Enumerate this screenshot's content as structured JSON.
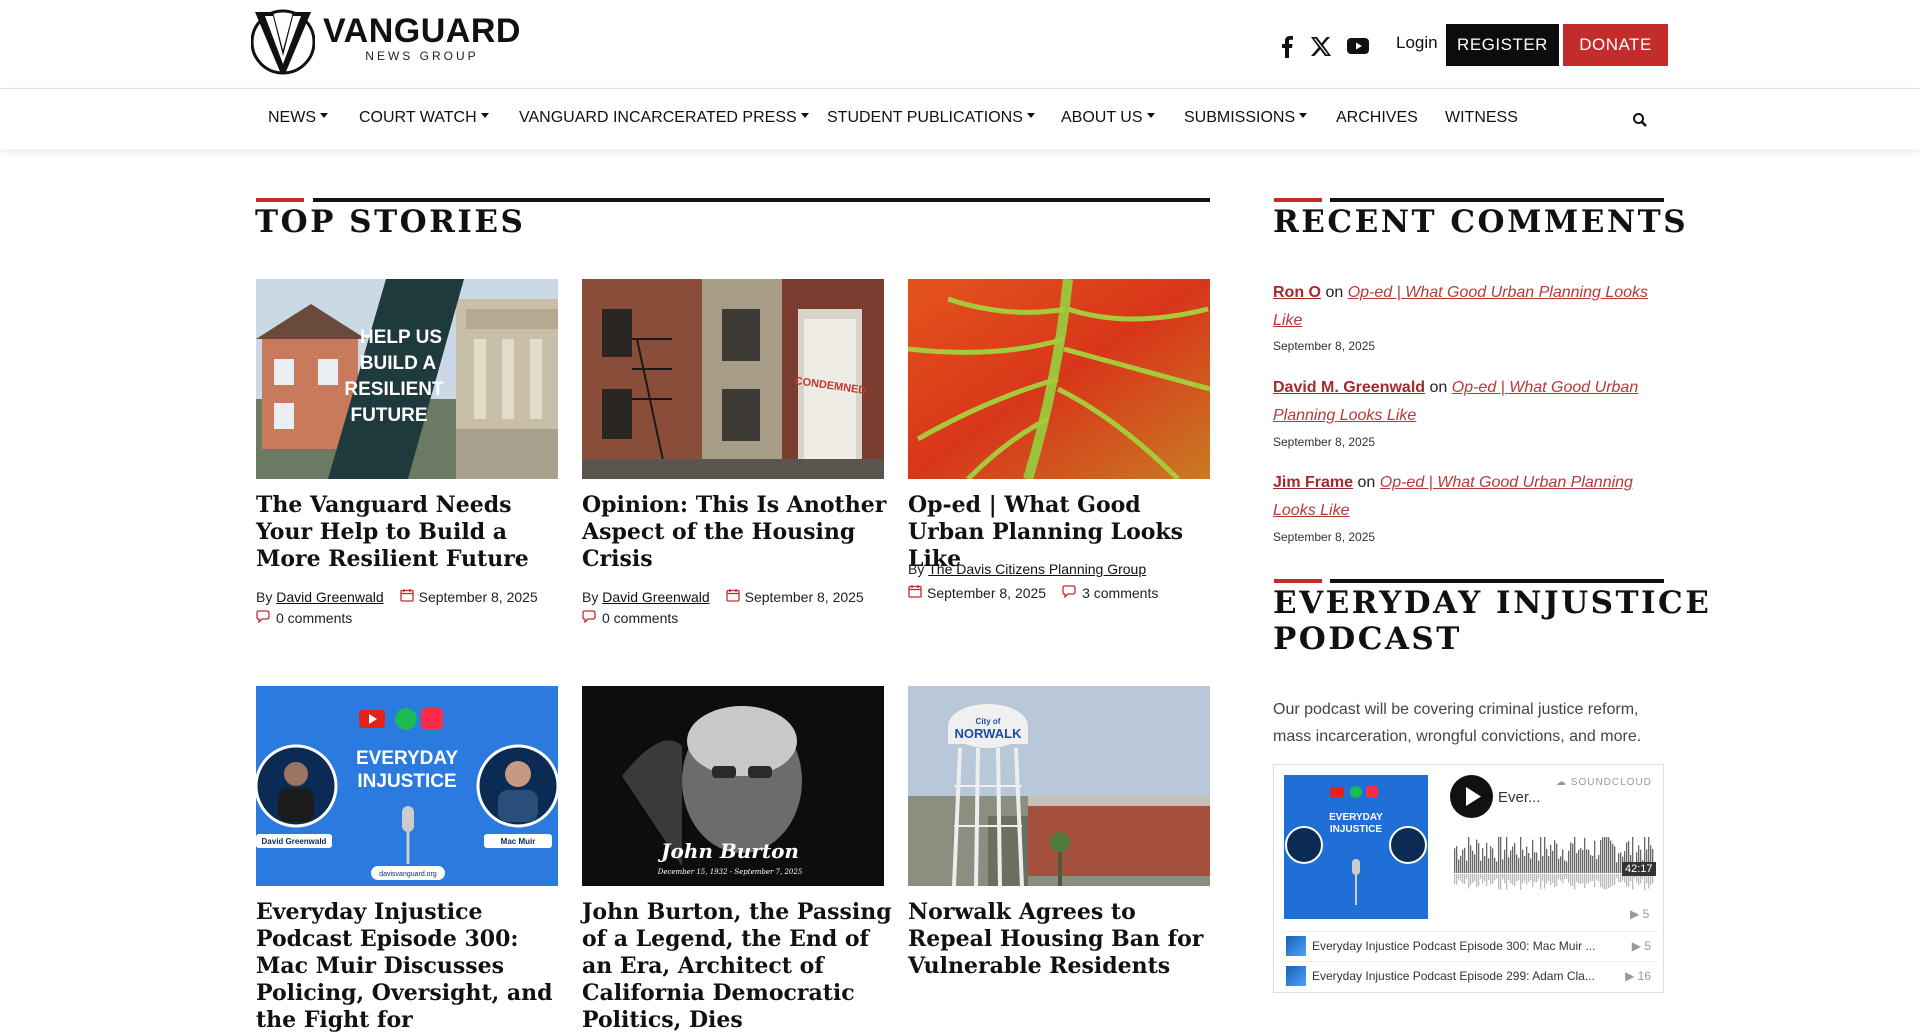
{
  "brand": {
    "name": "VANGUARD",
    "sub": "NEWS GROUP"
  },
  "header": {
    "social": [
      "facebook-icon",
      "x-icon",
      "youtube-icon"
    ],
    "login": "Login",
    "register": "REGISTER",
    "donate": "DONATE",
    "colors": {
      "donate": "#c42b2b",
      "register": "#0c0c0c",
      "accent": "#a52a2a"
    }
  },
  "nav": {
    "items": [
      {
        "label": "NEWS",
        "dropdown": true
      },
      {
        "label": "COURT WATCH",
        "dropdown": true
      },
      {
        "label": "VANGUARD INCARCERATED PRESS",
        "dropdown": true
      },
      {
        "label": "STUDENT PUBLICATIONS",
        "dropdown": true
      },
      {
        "label": "ABOUT US",
        "dropdown": true
      },
      {
        "label": "SUBMISSIONS",
        "dropdown": true
      },
      {
        "label": "ARCHIVES",
        "dropdown": false
      },
      {
        "label": "WITNESS",
        "dropdown": false
      }
    ]
  },
  "top_stories": {
    "heading": "TOP STORIES",
    "cards": [
      {
        "title": "The Vanguard Needs Your Help to Build a More Resilient Future",
        "by": "By",
        "author": "David Greenwald",
        "date": "September 8, 2025",
        "comments": "0 comments",
        "image_text": "HELP US BUILD A RESILIENT FUTURE"
      },
      {
        "title": "Opinion: This Is Another Aspect of the Housing Crisis",
        "by": "By",
        "author": "David Greenwald",
        "date": "September 8, 2025",
        "comments": "0 comments",
        "image_text": "CONDEMNED"
      },
      {
        "title": "Op-ed | What Good Urban Planning Looks Like",
        "by": "By",
        "author": "The Davis Citizens Planning Group",
        "date": "September 8, 2025",
        "comments": "3 comments"
      },
      {
        "title": "Everyday Injustice Podcast Episode 300: Mac Muir Discusses Policing, Oversight, and the Fight for",
        "image_text": "EVERYDAY INJUSTICE",
        "image_left": "David Greenwald",
        "image_right": "Mac Muir",
        "image_url": "davisvanguard.org"
      },
      {
        "title": "John Burton, the Passing of a Legend, the End of an Era, Architect of California Democratic Politics, Dies",
        "image_text": "John Burton",
        "image_sub": "December 15, 1932 - September 7, 2025"
      },
      {
        "title": "Norwalk Agrees to Repeal Housing Ban for Vulnerable Residents",
        "image_text": "NORWALK",
        "image_sub": "City of"
      }
    ]
  },
  "recent_comments": {
    "heading": "RECENT COMMENTS",
    "on": "on",
    "items": [
      {
        "author": "Ron O",
        "post": "Op-ed | What Good Urban Planning Looks Like",
        "date": "September 8, 2025"
      },
      {
        "author": "David M. Greenwald",
        "post": "Op-ed | What Good Urban Planning Looks Like",
        "date": "September 8, 2025"
      },
      {
        "author": "Jim Frame",
        "post": "Op-ed | What Good Urban Planning Looks Like",
        "date": "September 8, 2025"
      }
    ]
  },
  "podcast": {
    "heading_line1": "EVERYDAY INJUSTICE",
    "heading_line2": "PODCAST",
    "description": "Our podcast will be covering criminal justice reform, mass incarceration, wrongful convictions, and more.",
    "player": {
      "brand": "SOUNDCLOUD",
      "title": "Ever...",
      "duration": "42:17",
      "plays": "5",
      "art_text": "EVERYDAY INJUSTICE",
      "tracks": [
        {
          "title": "Everyday Injustice Podcast Episode 300: Mac Muir ...",
          "count": "5"
        },
        {
          "title": "Everyday Injustice Podcast Episode 299: Adam Cla...",
          "count": "16"
        }
      ]
    }
  }
}
